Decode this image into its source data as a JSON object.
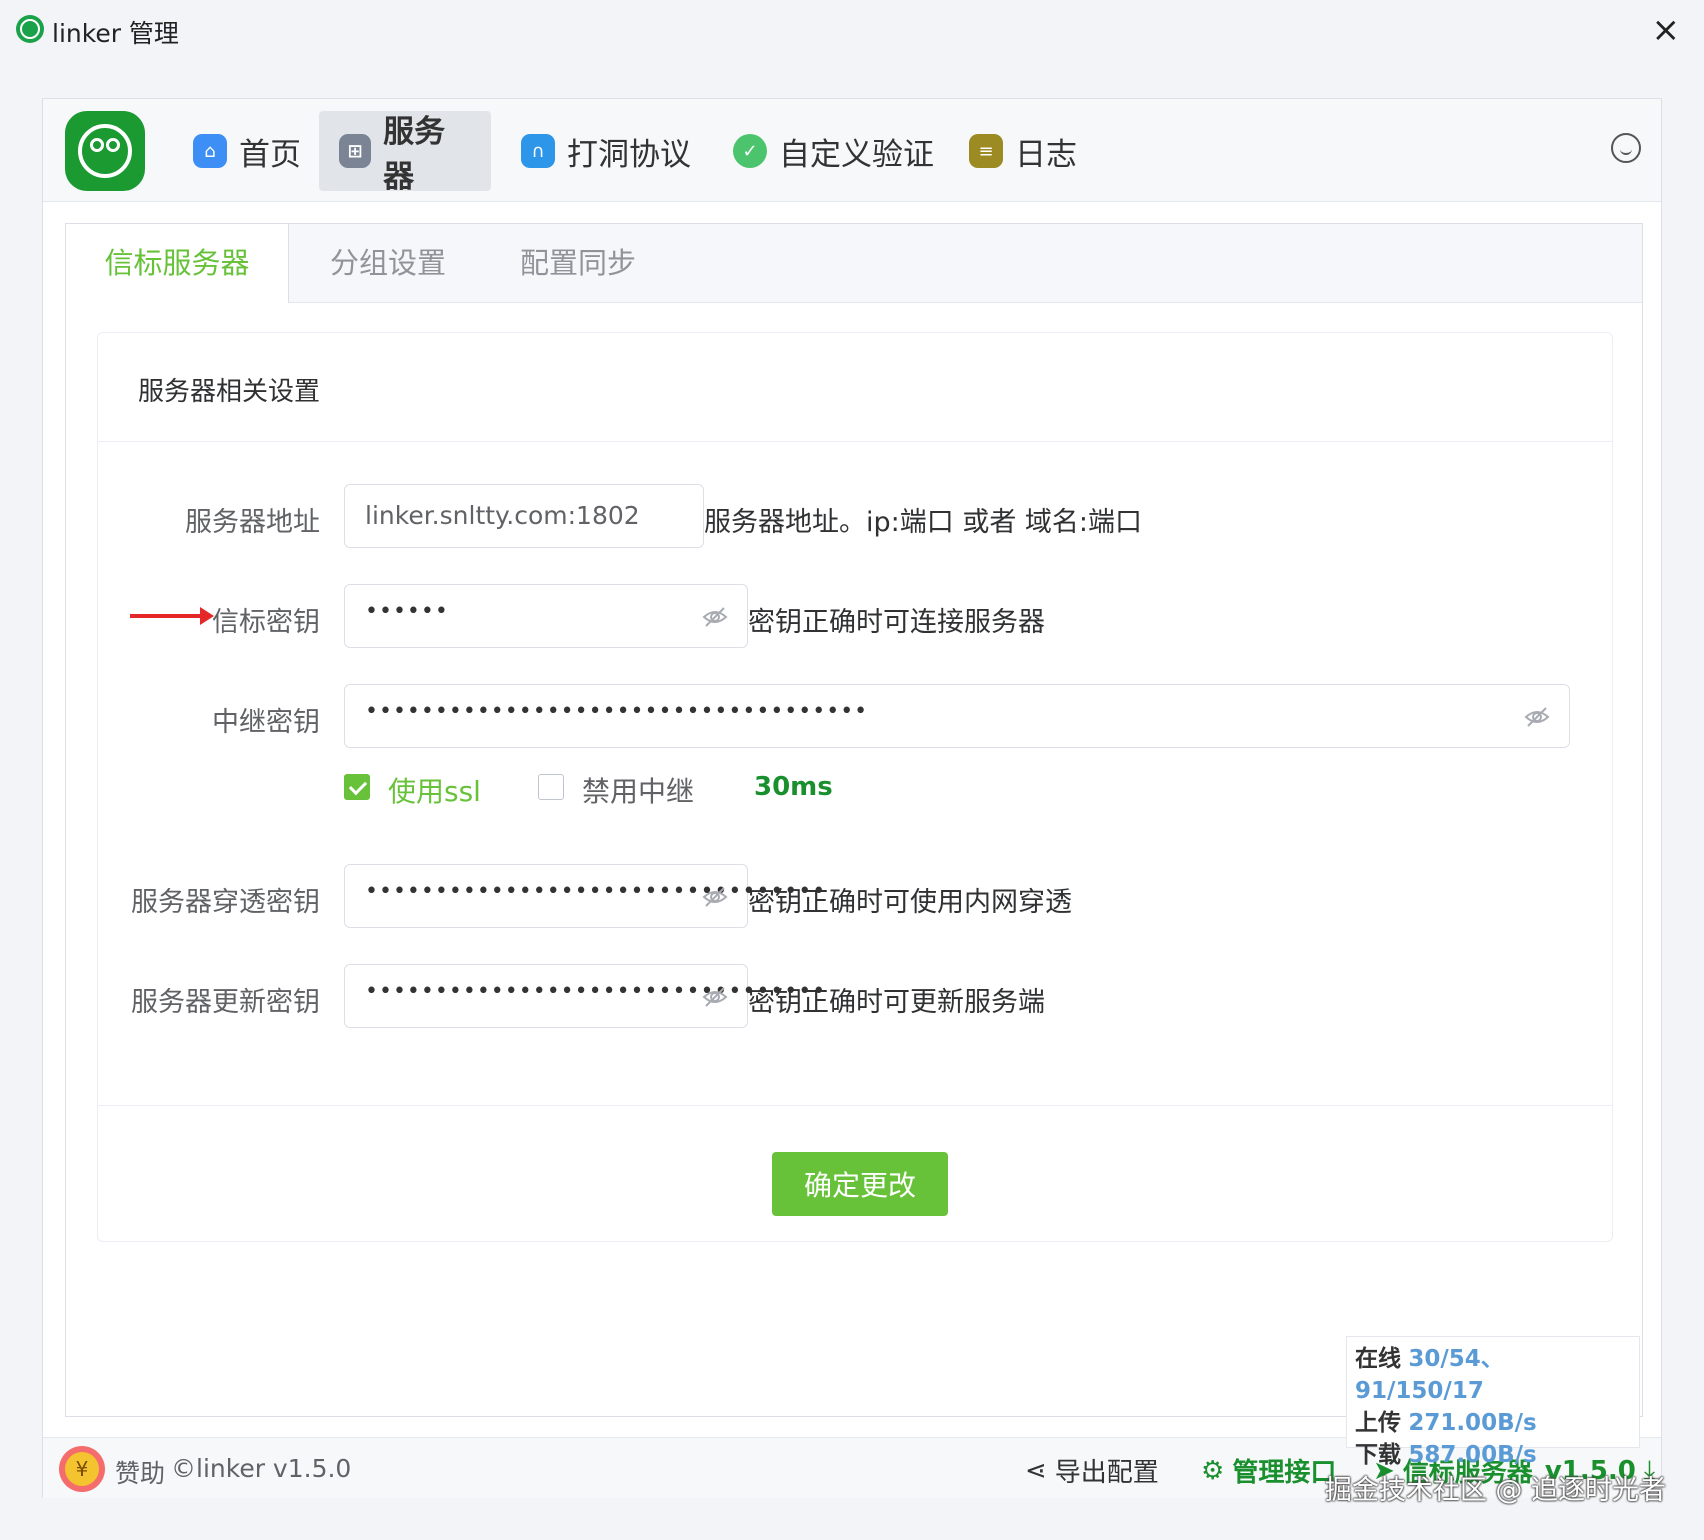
{
  "window": {
    "title": "linker 管理",
    "close_icon": "×"
  },
  "nav": {
    "items": [
      {
        "label": "首页",
        "icon": "home-icon",
        "color": "#3d8ff5"
      },
      {
        "label": "服务器",
        "icon": "server-icon",
        "color": "#7a8494"
      },
      {
        "label": "打洞协议",
        "icon": "tunnel-icon",
        "color": "#2d96e8"
      },
      {
        "label": "自定义验证",
        "icon": "shield-icon",
        "color": "#4cc46e"
      },
      {
        "label": "日志",
        "icon": "log-icon",
        "color": "#9c8a22"
      }
    ],
    "active_index": 1
  },
  "tabs": [
    "信标服务器",
    "分组设置",
    "配置同步"
  ],
  "panel": {
    "title": "服务器相关设置",
    "server_address": {
      "label": "服务器地址",
      "value": "linker.snltty.com:1802",
      "hint": "服务器地址。ip:端口 或者 域名:端口"
    },
    "beacon_key": {
      "label": "信标密钥",
      "value": "••••••",
      "hint": "密钥正确时可连接服务器"
    },
    "relay_key": {
      "label": "中继密钥",
      "value": "••••••••••••••••••••••••••••••••••••"
    },
    "use_ssl": {
      "label": "使用ssl",
      "checked": true
    },
    "disable_relay": {
      "label": "禁用中继",
      "checked": false
    },
    "latency": "30ms",
    "punch_key": {
      "label": "服务器穿透密钥",
      "value": "•••••••••••••••••••••••••••••••••",
      "hint": "密钥正确时可使用内网穿透"
    },
    "update_key": {
      "label": "服务器更新密钥",
      "value": "•••••••••••••••••••••••••••••••••",
      "hint": "密钥正确时可更新服务端"
    },
    "submit_label": "确定更改"
  },
  "footer": {
    "donate_label": "赞助",
    "donate_symbol": "¥",
    "copyright": "©linker v1.5.0",
    "export_label": "导出配置",
    "api_label": "管理接口",
    "server_label": "信标服务器",
    "server_version": "v1.5.0"
  },
  "stats": {
    "online_label": "在线",
    "online_value": "30/54、91/150/17",
    "upload_label": "上传",
    "upload_value": "271.00B/s",
    "download_label": "下载",
    "download_value": "587.00B/s"
  },
  "watermark": "掘金技术社区 @ 追逐时光者",
  "colors": {
    "accent": "#67c23a",
    "brand": "#1b9a32",
    "link_green": "#1a8f2e",
    "stat_blue": "#5b9bd5",
    "arrow_red": "#e62727"
  }
}
